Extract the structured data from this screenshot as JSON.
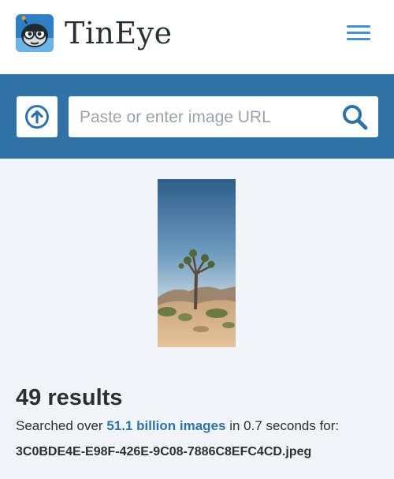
{
  "header": {
    "brand": "TinEye",
    "logo_icon": "tineye-robot-logo",
    "menu_icon": "hamburger-menu-icon"
  },
  "search": {
    "upload_icon": "upload-arrow-icon",
    "placeholder": "Paste or enter image URL",
    "value": "",
    "search_icon": "magnifier-icon"
  },
  "results": {
    "count_label": "49 results",
    "searched_prefix": "Searched over",
    "index_size_link": "51.1 billion images",
    "searched_suffix": "in 0.7 seconds for:",
    "filename": "3C0BDE4E-E98F-426E-9C08-7886C8EFC4CD.jpeg"
  },
  "colors": {
    "accent": "#2f72a8",
    "link": "#2f72a8",
    "menu": "#4a8fcf",
    "background": "#f1f5fa"
  }
}
